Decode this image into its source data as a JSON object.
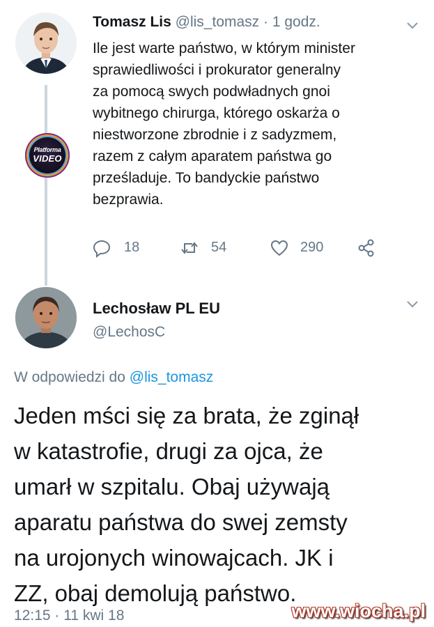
{
  "tweet1": {
    "name": "Tomasz Lis",
    "handle": "@lis_tomasz",
    "time": "· 1 godz.",
    "lines": [
      "Ile jest warte państwo, w którym minister",
      "sprawiedliwości i prokurator generalny",
      "za pomocą swych podwładnych gnoi",
      "wybitnego chirurga, którego oskarża o",
      "niestworzone zbrodnie i z sadyzmem,",
      "razem z całym aparatem państwa go",
      "prześladuje. To bandyckie państwo",
      "bezprawia."
    ],
    "replies": "18",
    "retweets": "54",
    "likes": "290"
  },
  "embedded_logo": {
    "line1": "Platforma",
    "line2": "VIDEO"
  },
  "tweet2": {
    "name": "Lechosław PL EU",
    "handle": "@LechosC",
    "reply_to_prefix": "W odpowiedzi do ",
    "reply_to_handle": "@lis_tomasz",
    "lines": [
      "Jeden mści się za brata, że zginął",
      "w katastrofie, drugi za ojca, że",
      "umarł w szpitalu. Obaj używają",
      "aparatu państwa do swej zemsty",
      "na urojonych winowajcach. JK i",
      "ZZ, obaj demolują państwo."
    ],
    "timestamp": "12:15 · 11 kwi 18"
  },
  "watermark": "www.wiocha.pl",
  "colors": {
    "link": "#1b95e0",
    "secondary_text": "#657786",
    "thread_line": "#ccd6dd"
  },
  "icons": [
    "reply-icon",
    "retweet-icon",
    "like-icon",
    "share-icon",
    "chevron-down-icon"
  ]
}
